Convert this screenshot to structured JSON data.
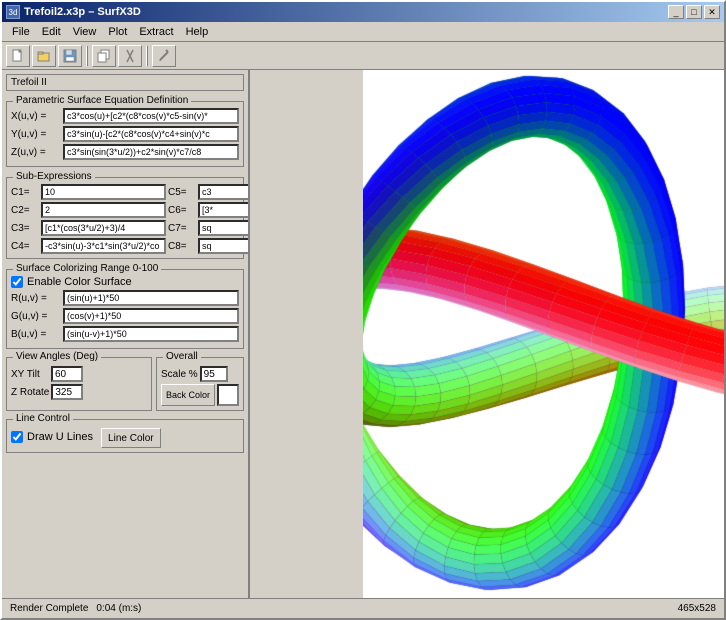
{
  "window": {
    "title": "Trefoil2.x3p – SurfX3D",
    "icon": "3d"
  },
  "title_buttons": {
    "minimize": "_",
    "maximize": "□",
    "close": "✕"
  },
  "menu": {
    "items": [
      "File",
      "Edit",
      "View",
      "Plot",
      "Extract",
      "Help"
    ]
  },
  "toolbar": {
    "buttons": [
      "new",
      "open",
      "save",
      "copy",
      "cut",
      "pencil"
    ]
  },
  "preset_name": "Trefoil II",
  "parametric": {
    "section_label": "Parametric Surface Equation Definition",
    "x_label": "X(u,v) =",
    "x_value": "c3*cos(u)+[c2*(c8*cos(v)*c5-sin(v)*",
    "y_label": "Y(u,v) =",
    "y_value": "c3*sin(u)-[c2*(c8*cos(v)*c4+sin(v)*c",
    "z_label": "Z(u,v) =",
    "z_value": "c3*sin(sin(3*u/2))+c2*sin(v)*c7/c8"
  },
  "sub_expressions": {
    "section_label": "Sub-Expressions",
    "c1_label": "C1=",
    "c1_value": "10",
    "c5_label": "C5=",
    "c5_value": "c3",
    "c2_label": "C2=",
    "c2_value": "2",
    "c6_label": "C6=",
    "c6_value": "[3*",
    "c3_label": "C3=",
    "c3_value": "[c1*(cos(3*u/2)+3)/4",
    "c7_label": "C7=",
    "c7_value": "sq",
    "c4_label": "C4=",
    "c4_value": "-c3*sin(u)-3*c1*sin(3*u/2)*co",
    "c8_label": "C8=",
    "c8_value": "sq"
  },
  "coloring": {
    "section_label": "Surface Colorizing   Range 0-100",
    "enable_label": "Enable Color Surface",
    "enable_checked": true,
    "r_label": "R(u,v) =",
    "r_value": "(sin(u)+1)*50",
    "g_label": "G(u,v) =",
    "g_value": "(cos(v)+1)*50",
    "b_label": "B(u,v) =",
    "b_value": "(sin(u-v)+1)*50"
  },
  "view_angles": {
    "section_label": "View Angles (Deg)",
    "xy_tilt_label": "XY Tilt",
    "xy_tilt_value": "60",
    "z_rotate_label": "Z Rotate",
    "z_rotate_value": "325"
  },
  "overall": {
    "section_label": "Overall",
    "scale_label": "Scale %",
    "scale_value": "95",
    "back_color_label": "Back Color",
    "color_swatch": "#ffffff"
  },
  "line_control": {
    "section_label": "Line Control",
    "draw_u_label": "Draw U Lines",
    "draw_u_checked": true,
    "line_color_label": "Line Color"
  },
  "status": {
    "render_label": "Render Complete",
    "render_time": "0:04 (m:s)",
    "dimensions": "465x528"
  }
}
